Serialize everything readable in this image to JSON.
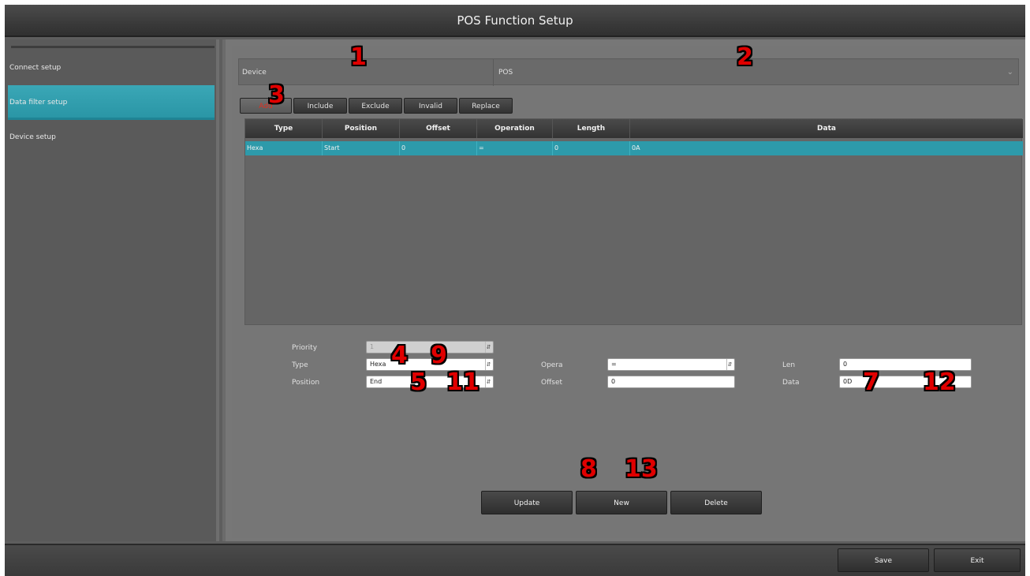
{
  "window": {
    "title": "POS Function Setup"
  },
  "sidebar": {
    "items": [
      {
        "label": "Connect setup"
      },
      {
        "label": "Data filter setup"
      },
      {
        "label": "Device setup"
      }
    ]
  },
  "device": {
    "label": "Device",
    "value": "POS"
  },
  "tabs": [
    {
      "label": "Add"
    },
    {
      "label": "Include"
    },
    {
      "label": "Exclude"
    },
    {
      "label": "Invalid"
    },
    {
      "label": "Replace"
    }
  ],
  "table": {
    "columns": [
      "Type",
      "Position",
      "Offset",
      "Operation",
      "Length",
      "Data"
    ],
    "rows": [
      {
        "type": "Hexa",
        "position": "Start",
        "offset": "0",
        "operation": "=",
        "length": "0",
        "data": "0A"
      }
    ]
  },
  "form": {
    "priority": {
      "label": "Priority",
      "value": "1"
    },
    "type": {
      "label": "Type",
      "value": "Hexa"
    },
    "position": {
      "label": "Position",
      "value": "End"
    },
    "opera": {
      "label": "Opera",
      "value": "="
    },
    "offset": {
      "label": "Offset",
      "value": "0"
    },
    "len": {
      "label": "Len",
      "value": "0"
    },
    "data": {
      "label": "Data",
      "value": "0D"
    }
  },
  "actions": {
    "update": "Update",
    "new": "New",
    "delete": "Delete"
  },
  "footer": {
    "save": "Save",
    "exit": "Exit"
  },
  "callouts": [
    "1",
    "2",
    "3",
    "4",
    "9",
    "5",
    "11",
    "7",
    "12",
    "8",
    "13"
  ],
  "colors": {
    "accent": "#2d9aaa",
    "callout": "#e00000"
  }
}
